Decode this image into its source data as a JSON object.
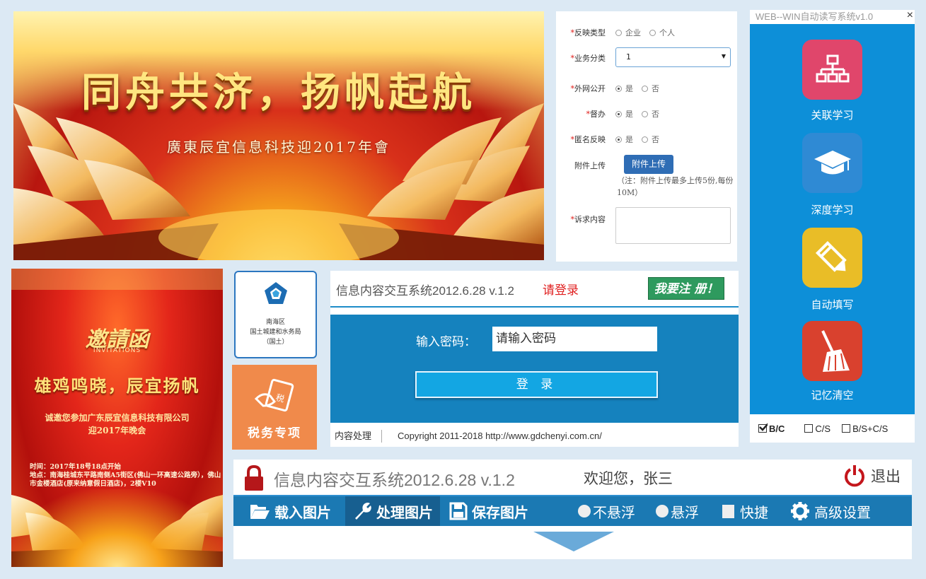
{
  "banner": {
    "title": "同舟共济，扬帆起航",
    "subtitle": "廣東辰宜信息科技迎2017年會"
  },
  "form": {
    "fields": [
      {
        "label": "反映类型",
        "required": true,
        "options": [
          "企业",
          "个人"
        ],
        "selected": -1
      },
      {
        "label": "业务分类",
        "required": true,
        "value": "1"
      },
      {
        "label": "外网公开",
        "required": true,
        "options": [
          "是",
          "否"
        ],
        "selected": 0
      },
      {
        "label": "督办",
        "required": true,
        "options": [
          "是",
          "否"
        ],
        "selected": 0
      },
      {
        "label": "匿名反映",
        "required": true,
        "options": [
          "是",
          "否"
        ],
        "selected": 0
      }
    ],
    "upload_label": "附件上传",
    "upload_button": "附件上传",
    "upload_note": "（注：附件上传最多上传5份,每份10M）",
    "appeal_label": "诉求内容",
    "required_mark": "*"
  },
  "sidepanel": {
    "title": "WEB--WIN自动读写系统v1.0",
    "close": "×",
    "tiles": [
      {
        "label": "关联学习",
        "icon": "network-icon",
        "color": "#e0466b"
      },
      {
        "label": "深度学习",
        "icon": "graduation-cap-icon",
        "color": "#2f8ad4"
      },
      {
        "label": "自动填写",
        "icon": "pencil-icon",
        "color": "#e9bd27"
      },
      {
        "label": "记忆清空",
        "icon": "broom-icon",
        "color": "#d9412e"
      }
    ],
    "modes": [
      {
        "label": "B/C",
        "checked": true
      },
      {
        "label": "C/S",
        "checked": false
      },
      {
        "label": "B/S+C/S",
        "checked": false
      }
    ]
  },
  "invitation": {
    "heading": "邀請函",
    "heading_en": "INVITATIONS",
    "slogan": "雄鸡鸣晓，辰宜扬帆",
    "line1": "诚邀您参加广东辰宜信息科技有限公司",
    "line2": "迎2017年晚会",
    "time": "时间：2017年18号18点开始",
    "address": "地点：南海桂城东平路南侧A5街区(佛山一环高速公路旁），佛山市金楼酒店(原来纳意假日酒店)，2楼V10"
  },
  "logo_tile": {
    "line1": "南海区",
    "line2": "国土城建和水务局",
    "line3": "（国土）"
  },
  "tax_tile": {
    "label": "税务专项"
  },
  "login": {
    "system_title": "信息内容交互系统2012.6.28  v.1.2",
    "please_login": "请登录",
    "register": "我要注 册！",
    "password_label": "输入密码：",
    "password_placeholder": "请输入密码",
    "login_button": "登 录",
    "footer_link": "内容处理",
    "copyright": "Copyright 2011-2018 http://www.gdchenyi.com.cn/"
  },
  "toolbar": {
    "system_title": "信息内容交互系统2012.6.28 v.1.2",
    "welcome": "欢迎您，张三",
    "logout": "退出",
    "buttons": [
      {
        "label": "载入图片",
        "icon": "folder-open-icon"
      },
      {
        "label": "处理图片",
        "icon": "wrench-icon",
        "active": true
      },
      {
        "label": "保存图片",
        "icon": "floppy-disk-icon"
      }
    ],
    "options": [
      {
        "label": "不悬浮",
        "type": "radio"
      },
      {
        "label": "悬浮",
        "type": "radio"
      },
      {
        "label": "快捷",
        "type": "checkbox"
      },
      {
        "label": "高级设置",
        "type": "settings"
      }
    ],
    "accent": "#1b79b3"
  }
}
